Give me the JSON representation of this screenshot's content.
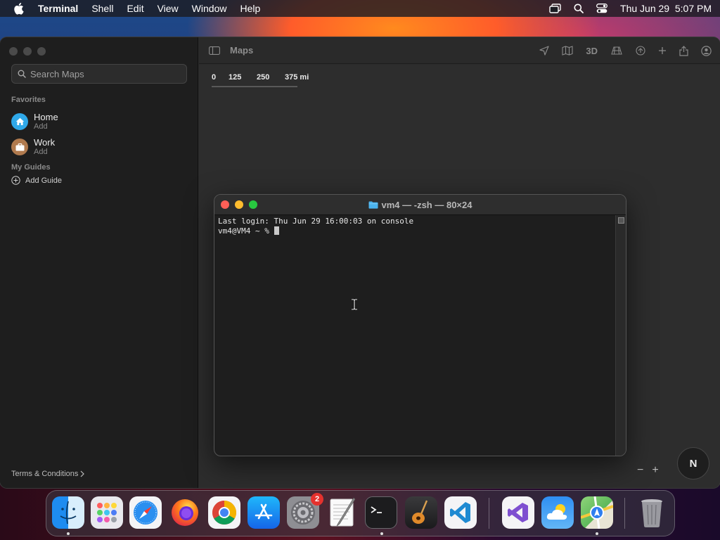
{
  "menubar": {
    "app_name": "Terminal",
    "items": [
      "Shell",
      "Edit",
      "View",
      "Window",
      "Help"
    ],
    "clock": "Thu Jun 29  5:07 PM"
  },
  "maps": {
    "window_title": "Maps",
    "search_placeholder": "Search Maps",
    "favorites_label": "Favorites",
    "favorites": [
      {
        "title": "Home",
        "subtitle": "Add"
      },
      {
        "title": "Work",
        "subtitle": "Add"
      }
    ],
    "guides_label": "My Guides",
    "add_guide_label": "Add Guide",
    "terms_label": "Terms & Conditions",
    "toolbar_3d_label": "3D",
    "scale_labels": [
      "0",
      "125",
      "250",
      "375 mi"
    ],
    "zoom_out_label": "−",
    "zoom_in_label": "+",
    "compass_label": "N"
  },
  "terminal": {
    "title": "vm4 — -zsh — 80×24",
    "lines": [
      "Last login: Thu Jun 29 16:00:03 on console",
      "vm4@VM4 ~ % "
    ]
  },
  "dock": {
    "settings_badge": "2"
  },
  "colors": {
    "close": "#ff5f57",
    "minimize": "#febc2e",
    "maximize": "#28c840",
    "home_icon_bg": "#2fa8e8",
    "work_icon_bg": "#b07a4e"
  }
}
